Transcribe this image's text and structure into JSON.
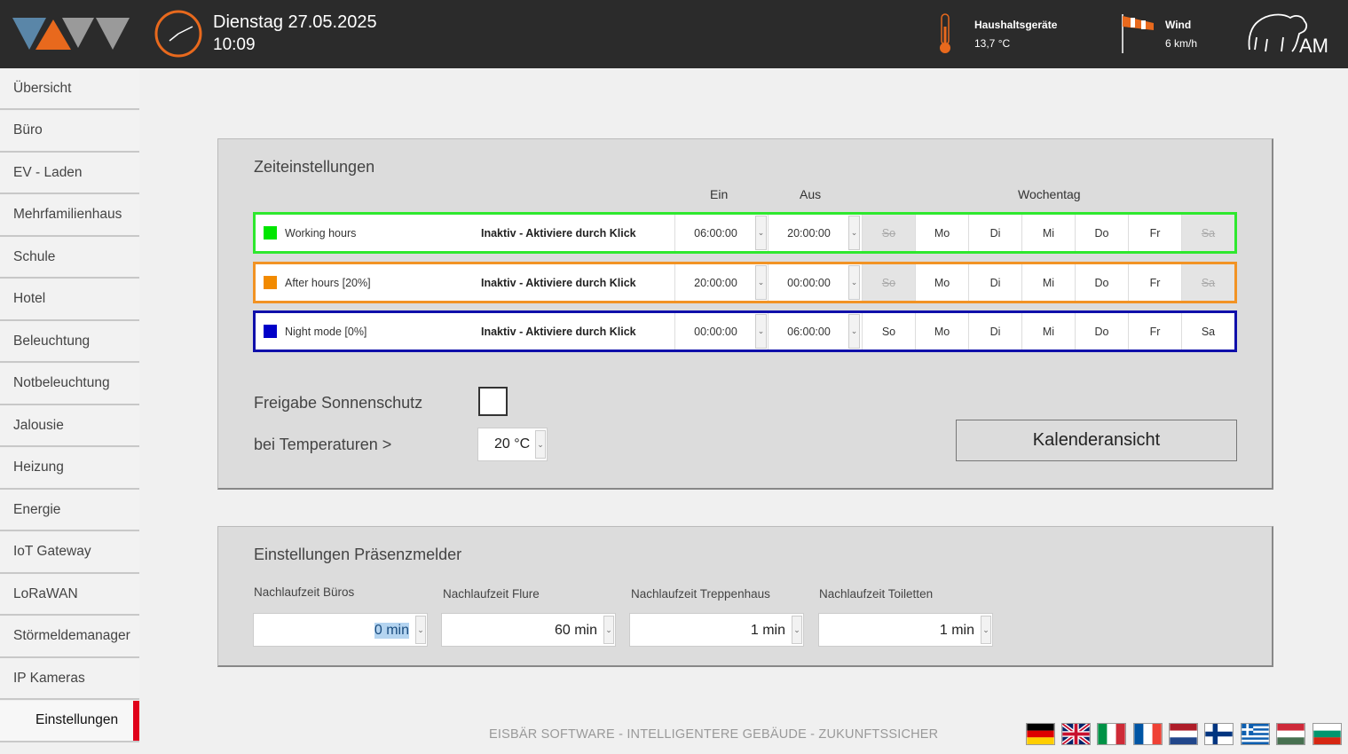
{
  "header": {
    "date": "Dienstag 27.05.2025",
    "time": "10:09",
    "weather1_label": "Haushaltsgeräte",
    "weather1_value": "13,7 °C",
    "weather2_label": "Wind",
    "weather2_value": "6 km/h",
    "brand_text": "AM"
  },
  "colors": {
    "accent_orange": "#e8691d",
    "header_bg": "#2b2b2b",
    "active_marker": "#e0001a",
    "row_green": "#2ee82e",
    "row_orange": "#f29324",
    "row_blue": "#1010aa"
  },
  "sidebar": {
    "items": [
      "Übersicht",
      "Büro",
      "EV - Laden",
      "Mehrfamilienhaus",
      "Schule",
      "Hotel",
      "Beleuchtung",
      "Notbeleuchtung",
      "Jalousie",
      "Heizung",
      "Energie",
      "IoT Gateway",
      "LoRaWAN",
      "Störmeldemanager",
      "IP Kameras",
      "Einstellungen"
    ],
    "active": "Einstellungen"
  },
  "zeit": {
    "title": "Zeiteinstellungen",
    "col_ein": "Ein",
    "col_aus": "Aus",
    "col_wochentag": "Wochentag",
    "rows": [
      {
        "name": "Working hours",
        "status": "Inaktiv - Aktiviere durch Klick",
        "ein": "06:00:00",
        "aus": "20:00:00",
        "color": "#00e600",
        "days": [
          [
            "So",
            false
          ],
          [
            "Mo",
            true
          ],
          [
            "Di",
            true
          ],
          [
            "Mi",
            true
          ],
          [
            "Do",
            true
          ],
          [
            "Fr",
            true
          ],
          [
            "Sa",
            false
          ]
        ]
      },
      {
        "name": "After hours [20%]",
        "status": "Inaktiv - Aktiviere durch Klick",
        "ein": "20:00:00",
        "aus": "00:00:00",
        "color": "#f28a00",
        "days": [
          [
            "So",
            false
          ],
          [
            "Mo",
            true
          ],
          [
            "Di",
            true
          ],
          [
            "Mi",
            true
          ],
          [
            "Do",
            true
          ],
          [
            "Fr",
            true
          ],
          [
            "Sa",
            false
          ]
        ]
      },
      {
        "name": "Night mode [0%]",
        "status": "Inaktiv - Aktiviere durch Klick",
        "ein": "00:00:00",
        "aus": "06:00:00",
        "color": "#0000c8",
        "days": [
          [
            "So",
            true
          ],
          [
            "Mo",
            true
          ],
          [
            "Di",
            true
          ],
          [
            "Mi",
            true
          ],
          [
            "Do",
            true
          ],
          [
            "Fr",
            true
          ],
          [
            "Sa",
            true
          ]
        ]
      }
    ],
    "sonnenschutz_label": "Freigabe Sonnenschutz",
    "sonnenschutz_checked": false,
    "temp_label": "bei Temperaturen >",
    "temp_value": "20 °C",
    "calendar_button": "Kalenderansicht",
    "dropdown_glyph": "⌄"
  },
  "praesenz": {
    "title": "Einstellungen Präsenzmelder",
    "fields": [
      {
        "label": "Nachlaufzeit Büros",
        "value": "0 min",
        "selected": true
      },
      {
        "label": "Nachlaufzeit Flure",
        "value": "60 min",
        "selected": false
      },
      {
        "label": "Nachlaufzeit Treppenhaus",
        "value": "1 min",
        "selected": false
      },
      {
        "label": "Nachlaufzeit Toiletten",
        "value": "1 min",
        "selected": false
      }
    ]
  },
  "footer": {
    "text": "EISBÄR SOFTWARE - INTELLIGENTERE GEBÄUDE - ZUKUNFTSSICHER",
    "flags": [
      "de-flag-icon",
      "uk-flag-icon",
      "it-flag-icon",
      "fr-flag-icon",
      "nl-flag-icon",
      "fi-flag-icon",
      "gr-flag-icon",
      "hu-flag-icon",
      "bg-flag-icon"
    ]
  }
}
